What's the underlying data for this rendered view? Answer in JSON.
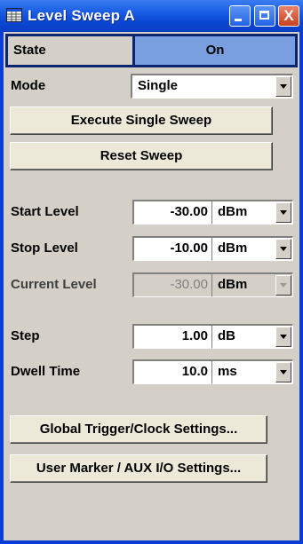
{
  "window": {
    "title": "Level Sweep  A",
    "icon": "table-icon",
    "close_glyph": "X"
  },
  "state": {
    "label": "State",
    "value": "On",
    "color": "#7a9fe0"
  },
  "mode": {
    "label": "Mode",
    "value": "Single"
  },
  "buttons": {
    "execute": "Execute Single Sweep",
    "reset": "Reset Sweep",
    "global_trigger": "Global Trigger/Clock Settings...",
    "user_marker": "User Marker / AUX I/O Settings..."
  },
  "params": [
    {
      "label": "Start Level",
      "value": "-30.00",
      "unit": "dBm",
      "enabled": true
    },
    {
      "label": "Stop Level",
      "value": "-10.00",
      "unit": "dBm",
      "enabled": true
    },
    {
      "label": "Current Level",
      "value": "-30.00",
      "unit": "dBm",
      "enabled": false
    },
    {
      "label": "Step",
      "value": "1.00",
      "unit": "dB",
      "enabled": true
    },
    {
      "label": "Dwell Time",
      "value": "10.0",
      "unit": "ms",
      "enabled": true
    }
  ],
  "colors": {
    "title_bar": "#1b5fe6",
    "panel": "#d4d0c8",
    "state_on": "#7a9fe0",
    "frame": "#0a2470"
  }
}
